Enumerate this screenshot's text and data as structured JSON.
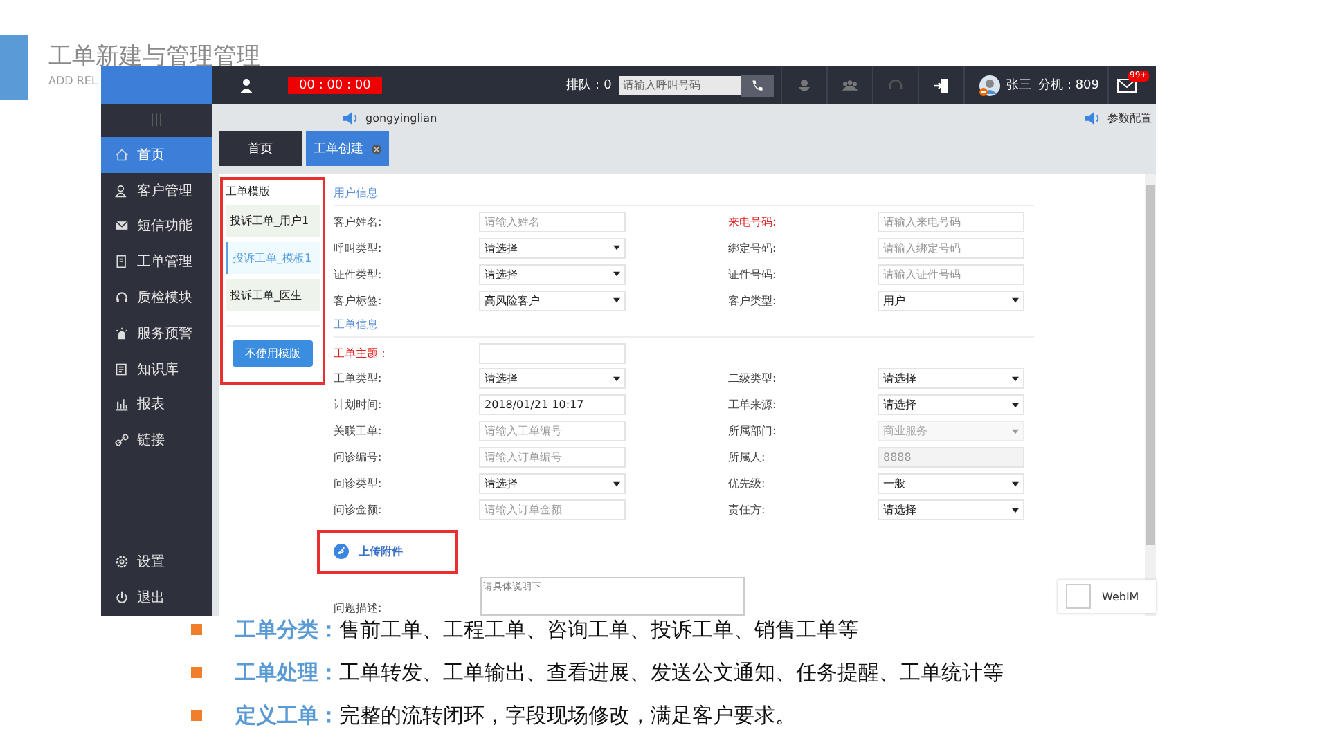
{
  "slide": {
    "title": "工单新建与管理管理",
    "subtitle": "ADD REL"
  },
  "topbar": {
    "timer": "00 : 00 : 00",
    "queue": "排队：0",
    "search": {
      "placeholder": "请输入呼叫号码"
    },
    "user_name": "张三",
    "extension": "分机：809",
    "mail_badge": "99+"
  },
  "sidebar": {
    "handle": "|||",
    "items": [
      {
        "label": "首页",
        "selected": true
      },
      {
        "label": "客户管理",
        "selected": false
      },
      {
        "label": "短信功能",
        "selected": false
      },
      {
        "label": "工单管理",
        "selected": false
      },
      {
        "label": "质检模块",
        "selected": false
      },
      {
        "label": "服务预警",
        "selected": false
      },
      {
        "label": "知识库",
        "selected": false
      },
      {
        "label": "报表",
        "selected": false
      },
      {
        "label": "链接",
        "selected": false
      }
    ],
    "bottom_items": [
      {
        "label": "设置"
      },
      {
        "label": "退出"
      }
    ]
  },
  "account": "gongyinglian",
  "settings_link": "参数配置",
  "tabs": [
    {
      "label": "首页",
      "selected": false,
      "closable": false
    },
    {
      "label": "工单创建",
      "selected": true,
      "closable": true
    }
  ],
  "templates": {
    "title": "工单模版",
    "items": [
      {
        "label": "投诉工单_用户1",
        "selected": false
      },
      {
        "label": "投诉工单_模板1",
        "selected": true
      },
      {
        "label": "投诉工单_医生",
        "selected": false
      }
    ],
    "button": "不使用模版"
  },
  "sections": [
    {
      "title": "用户信息",
      "rows": [
        [
          {
            "label": "客户姓名:",
            "required": false,
            "kind": "input",
            "placeholder": "请输入姓名",
            "disabled": false
          },
          {
            "label": "来电号码:",
            "required": true,
            "kind": "input",
            "placeholder": "请输入来电号码",
            "disabled": false
          }
        ],
        [
          {
            "label": "呼叫类型:",
            "required": false,
            "kind": "select",
            "value": "请选择",
            "disabled": false
          },
          {
            "label": "绑定号码:",
            "required": false,
            "kind": "input",
            "placeholder": "请输入绑定号码",
            "disabled": false
          }
        ],
        [
          {
            "label": "证件类型:",
            "required": false,
            "kind": "select",
            "value": "请选择",
            "disabled": false
          },
          {
            "label": "证件号码:",
            "required": false,
            "kind": "input",
            "placeholder": "请输入证件号码",
            "disabled": false
          }
        ],
        [
          {
            "label": "客户标签:",
            "required": false,
            "kind": "select",
            "value": "高风险客户",
            "disabled": false
          },
          {
            "label": "客户类型:",
            "required": false,
            "kind": "select",
            "value": "用户",
            "disabled": false
          }
        ]
      ]
    },
    {
      "title": "工单信息",
      "rows": [
        [
          {
            "label": "工单主题：",
            "required": true,
            "kind": "input",
            "disabled": false
          }
        ],
        [
          {
            "label": "工单类型:",
            "required": false,
            "kind": "select",
            "value": "请选择",
            "disabled": false
          },
          {
            "label": "二级类型:",
            "required": false,
            "kind": "select",
            "value": "请选择",
            "disabled": false
          }
        ],
        [
          {
            "label": "计划时间:",
            "required": false,
            "kind": "input",
            "value": "2018/01/21 10:17",
            "disabled": false
          },
          {
            "label": "工单来源:",
            "required": false,
            "kind": "select",
            "value": "请选择",
            "disabled": false
          }
        ],
        [
          {
            "label": "关联工单:",
            "required": false,
            "kind": "input",
            "placeholder": "请输入工单编号",
            "disabled": false
          },
          {
            "label": "所属部门:",
            "required": false,
            "kind": "select",
            "value": "商业服务",
            "disabled": true
          }
        ],
        [
          {
            "label": "问诊编号:",
            "required": false,
            "kind": "input",
            "placeholder": "请输入订单编号",
            "disabled": false
          },
          {
            "label": "所属人:",
            "required": false,
            "kind": "input",
            "value": "8888",
            "disabled": true
          }
        ],
        [
          {
            "label": "问诊类型:",
            "required": false,
            "kind": "select",
            "value": "请选择",
            "disabled": false
          },
          {
            "label": "优先级:",
            "required": false,
            "kind": "select",
            "value": "一般",
            "disabled": false
          }
        ],
        [
          {
            "label": "问诊金额:",
            "required": false,
            "kind": "input",
            "placeholder": "请输入订单金额",
            "disabled": false
          },
          {
            "label": "责任方:",
            "required": false,
            "kind": "select",
            "value": "请选择",
            "disabled": false
          }
        ]
      ]
    }
  ],
  "upload": "上传附件",
  "description": {
    "label": "问题描述:",
    "placeholder": "请具体说明下"
  },
  "webim": "WebIM",
  "bullets": [
    {
      "label": "工单分类：",
      "text": "售前工单、工程工单、咨询工单、投诉工单、销售工单等"
    },
    {
      "label": "工单处理：",
      "text": "工单转发、工单输出、查看进展、发送公文通知、任务提醒、工单统计等"
    },
    {
      "label": "定义工单：",
      "text": "完整的流转闭环，字段现场修改，满足客户要求。"
    }
  ]
}
